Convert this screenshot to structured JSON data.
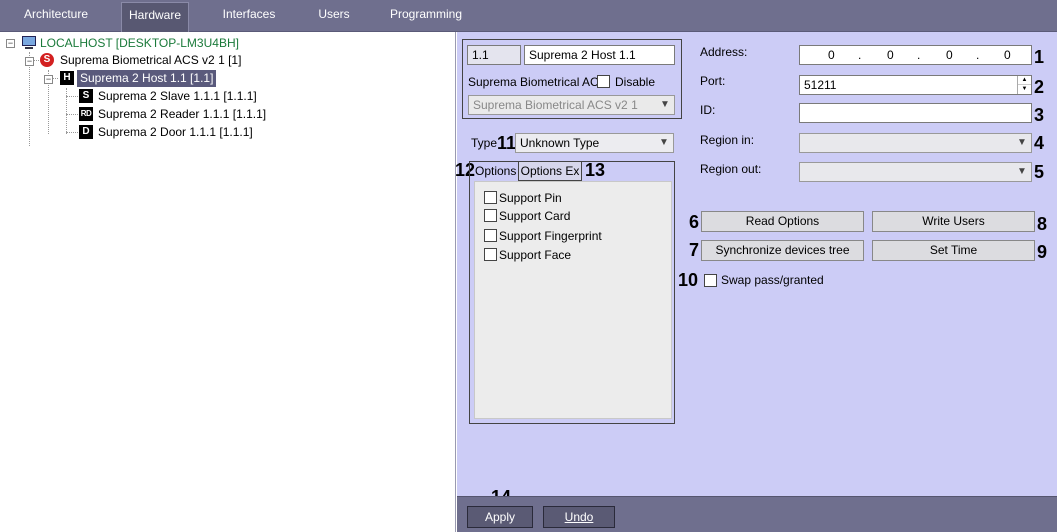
{
  "tabs": [
    {
      "label": "Architecture",
      "active": false
    },
    {
      "label": "Hardware",
      "active": true
    },
    {
      "label": "Interfaces",
      "active": false
    },
    {
      "label": "Users",
      "active": false
    },
    {
      "label": "Programming",
      "active": false
    }
  ],
  "tree": {
    "root": {
      "label": "LOCALHOST [DESKTOP-LM3U4BH]",
      "icon": "computer-icon",
      "color": "#1a7a3a"
    },
    "acs": {
      "label": "Suprema Biometrical ACS v2 1 [1]",
      "badge": "S"
    },
    "host": {
      "label": "Suprema 2 Host 1.1 [1.1]",
      "badge": "H",
      "selected": true
    },
    "children": [
      {
        "label": "Suprema 2 Slave 1.1.1 [1.1.1]",
        "badge": "S"
      },
      {
        "label": "Suprema 2 Reader 1.1.1 [1.1.1]",
        "badge": "RD"
      },
      {
        "label": "Suprema 2 Door 1.1.1 [1.1.1]",
        "badge": "D"
      }
    ]
  },
  "form": {
    "id_value": "1.1",
    "name_value": "Suprema 2 Host 1.1",
    "parent_label": "Suprema Biometrical ACS",
    "disable_label": "Disable",
    "parent_combo": "Suprema Biometrical ACS v2 1",
    "type_label": "Type",
    "type_value": "Unknown Type",
    "subtab_options": "Options",
    "subtab_options_ex": "Options Ex",
    "checkboxes": [
      "Support Pin",
      "Support Card",
      "Support Fingerprint",
      "Support Face"
    ],
    "address_label": "Address:",
    "address_octets": [
      "0",
      "0",
      "0",
      "0"
    ],
    "address_dot": ".",
    "port_label": "Port:",
    "port_value": "51211",
    "id_label": "ID:",
    "region_in_label": "Region in:",
    "region_out_label": "Region out:",
    "read_options": "Read Options",
    "write_users": "Write Users",
    "sync_tree": "Synchronize devices tree",
    "set_time": "Set Time",
    "swap_label": "Swap pass/granted"
  },
  "callouts": [
    "1",
    "2",
    "3",
    "4",
    "5",
    "6",
    "7",
    "8",
    "9",
    "10",
    "11",
    "12",
    "13",
    "14"
  ],
  "bottom": {
    "apply": "Apply",
    "undo": "Undo"
  },
  "colors": {
    "panel": "#ccccf6",
    "bar": "#6f6f8e",
    "selected": "#5a5a7c"
  }
}
